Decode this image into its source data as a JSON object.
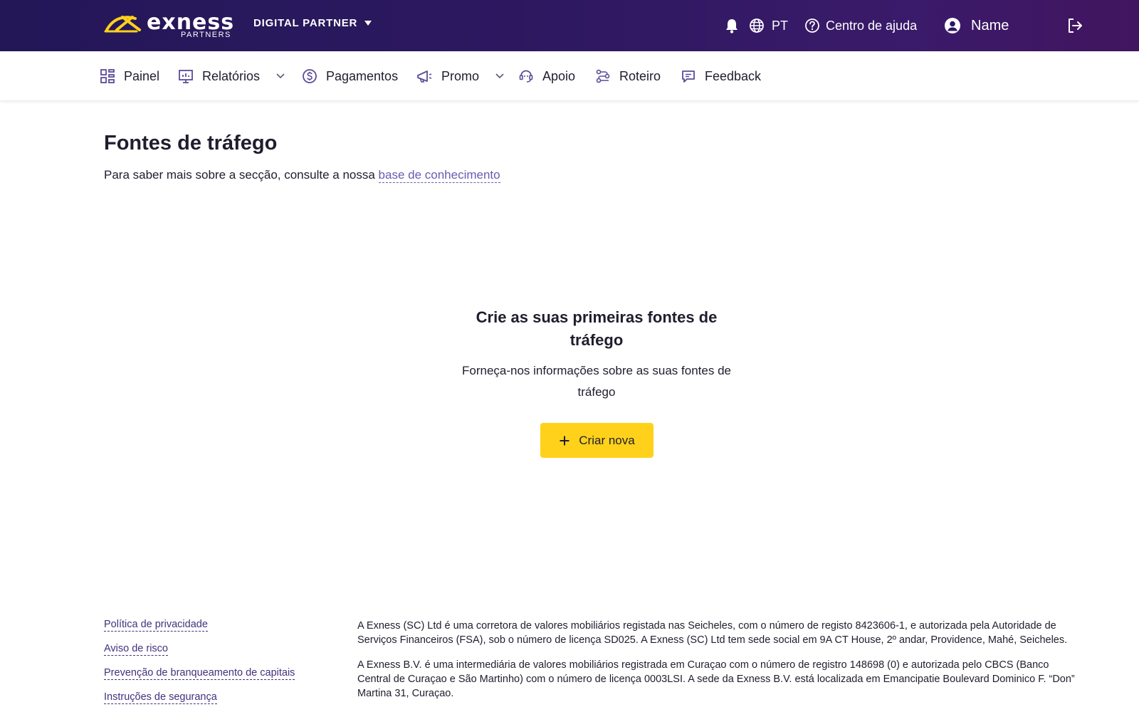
{
  "header": {
    "brand": "exness",
    "brand_sub": "PARTNERS",
    "partner_type": "DIGITAL PARTNER",
    "language": "PT",
    "help_label": "Centro de ajuda",
    "user_name": "Name",
    "brand_color": "#FFD11A",
    "bg_color": "#2D1860"
  },
  "nav": {
    "items": [
      {
        "label": "Painel",
        "icon": "dashboard-icon"
      },
      {
        "label": "Relatórios",
        "icon": "reports-icon",
        "dropdown": true
      },
      {
        "label": "Pagamentos",
        "icon": "dollar-icon"
      },
      {
        "label": "Promo",
        "icon": "megaphone-icon",
        "dropdown": true
      },
      {
        "label": "Apoio",
        "icon": "support-icon"
      },
      {
        "label": "Roteiro",
        "icon": "roadmap-icon"
      },
      {
        "label": "Feedback",
        "icon": "feedback-icon"
      }
    ]
  },
  "main": {
    "title": "Fontes de tráfego",
    "intro_text": "Para saber mais sobre a secção, consulte a nossa ",
    "intro_link": "base de conhecimento",
    "empty_title": "Crie as suas primeiras fontes de tráfego",
    "empty_text": "Forneça-nos informações sobre as suas fontes de tráfego",
    "create_label": "Criar nova",
    "accent_color": "#FFD11A"
  },
  "footer": {
    "links": [
      "Política de privacidade",
      "Aviso de risco",
      "Prevenção de branqueamento de capitais",
      "Instruções de segurança"
    ],
    "legal": [
      "A Exness (SC) Ltd é uma corretora de valores mobiliários registada nas Seicheles, com o número de registo 8423606-1, e autorizada pela Autoridade de Serviços Financeiros (FSA), sob o número de licença SD025. A Exness (SC) Ltd tem sede social em 9A CT House, 2º andar, Providence, Mahé, Seicheles.",
      "A Exness B.V. é uma intermediária de valores mobiliários registrada em Curaçao com o número de registro 148698 (0) e autorizada pelo CBCS (Banco Central de Curaçao e São Martinho) com o número de licença 0003LSI. A sede da Exness B.V. está localizada em Emancipatie Boulevard Dominico F. “Don” Martina 31, Curaçao."
    ]
  }
}
